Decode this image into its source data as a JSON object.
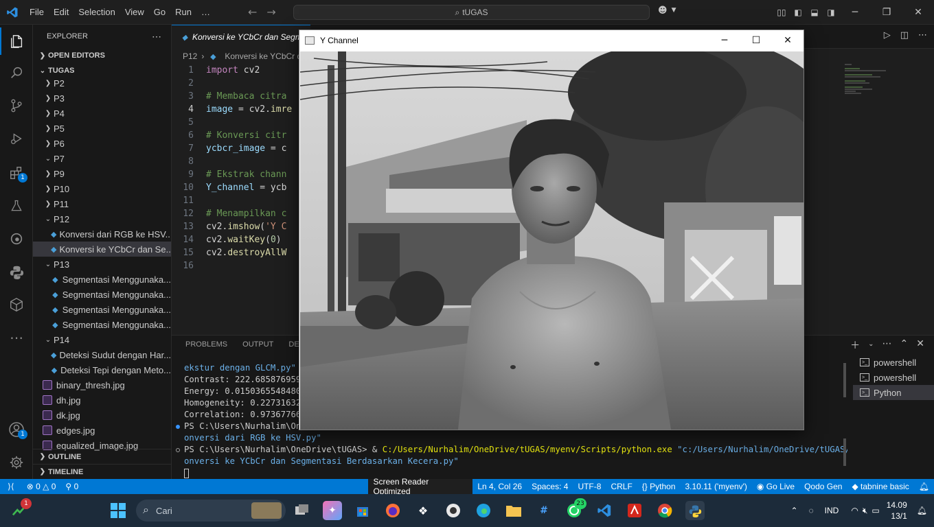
{
  "titlebar": {
    "menus": [
      "File",
      "Edit",
      "Selection",
      "View",
      "Go",
      "Run",
      "…"
    ],
    "search_text": "tUGAS"
  },
  "activity": {
    "extensions_badge": "1",
    "accounts_badge": "1"
  },
  "explorer": {
    "title": "EXPLORER",
    "open_editors": "OPEN EDITORS",
    "workspace": "TUGAS",
    "rows": [
      {
        "label": "P2",
        "type": "folder-closed"
      },
      {
        "label": "P3",
        "type": "folder-closed"
      },
      {
        "label": "P4",
        "type": "folder-closed"
      },
      {
        "label": "P5",
        "type": "folder-closed"
      },
      {
        "label": "P6",
        "type": "folder-closed"
      },
      {
        "label": "P7",
        "type": "folder-open"
      },
      {
        "label": "P9",
        "type": "folder-closed"
      },
      {
        "label": "P10",
        "type": "folder-closed"
      },
      {
        "label": "P11",
        "type": "folder-closed"
      },
      {
        "label": "P12",
        "type": "folder-open"
      },
      {
        "label": "Konversi dari RGB ke HSV....",
        "type": "py"
      },
      {
        "label": "Konversi ke YCbCr dan Se...",
        "type": "py",
        "selected": true
      },
      {
        "label": "P13",
        "type": "folder-open"
      },
      {
        "label": "Segmentasi Menggunaka...",
        "type": "py"
      },
      {
        "label": "Segmentasi Menggunaka...",
        "type": "py"
      },
      {
        "label": "Segmentasi Menggunaka...",
        "type": "py"
      },
      {
        "label": "Segmentasi Menggunaka...",
        "type": "py"
      },
      {
        "label": "P14",
        "type": "folder-open"
      },
      {
        "label": "Deteksi Sudut dengan Har...",
        "type": "py"
      },
      {
        "label": "Deteksi Tepi dengan Meto...",
        "type": "py"
      },
      {
        "label": "binary_thresh.jpg",
        "type": "img"
      },
      {
        "label": "dh.jpg",
        "type": "img"
      },
      {
        "label": "dk.jpg",
        "type": "img"
      },
      {
        "label": "edges.jpg",
        "type": "img"
      },
      {
        "label": "equalized_image.jpg",
        "type": "img"
      }
    ],
    "outline": "OUTLINE",
    "timeline": "TIMELINE"
  },
  "editor": {
    "tab_label": "Konversi ke YCbCr dan Segm",
    "breadcrumb_folder": "P12",
    "breadcrumb_file": "Konversi ke YCbCr d",
    "lines": [
      {
        "n": "1",
        "parts": [
          {
            "c": "c-kw",
            "t": "import"
          },
          {
            "c": "c-plain",
            "t": " cv2"
          }
        ]
      },
      {
        "n": "2",
        "parts": []
      },
      {
        "n": "3",
        "parts": [
          {
            "c": "c-cm",
            "t": "# Membaca citra"
          }
        ]
      },
      {
        "n": "4",
        "parts": [
          {
            "c": "c-var",
            "t": "image"
          },
          {
            "c": "c-plain",
            "t": " = cv2."
          },
          {
            "c": "c-fn",
            "t": "imre"
          }
        ]
      },
      {
        "n": "5",
        "parts": []
      },
      {
        "n": "6",
        "parts": [
          {
            "c": "c-cm",
            "t": "# Konversi citr"
          }
        ]
      },
      {
        "n": "7",
        "parts": [
          {
            "c": "c-var",
            "t": "ycbcr_image"
          },
          {
            "c": "c-plain",
            "t": " = c"
          }
        ]
      },
      {
        "n": "8",
        "parts": []
      },
      {
        "n": "9",
        "parts": [
          {
            "c": "c-cm",
            "t": "# Ekstrak chann"
          }
        ]
      },
      {
        "n": "10",
        "parts": [
          {
            "c": "c-var",
            "t": "Y_channel"
          },
          {
            "c": "c-plain",
            "t": " = ycb"
          }
        ]
      },
      {
        "n": "11",
        "parts": []
      },
      {
        "n": "12",
        "parts": [
          {
            "c": "c-cm",
            "t": "# Menampilkan c"
          }
        ]
      },
      {
        "n": "13",
        "parts": [
          {
            "c": "c-plain",
            "t": "cv2."
          },
          {
            "c": "c-fn",
            "t": "imshow"
          },
          {
            "c": "c-plain",
            "t": "("
          },
          {
            "c": "c-str",
            "t": "'Y C"
          }
        ]
      },
      {
        "n": "14",
        "parts": [
          {
            "c": "c-plain",
            "t": "cv2."
          },
          {
            "c": "c-fn",
            "t": "waitKey"
          },
          {
            "c": "c-plain",
            "t": "("
          },
          {
            "c": "c-num",
            "t": "0"
          },
          {
            "c": "c-plain",
            "t": ")"
          }
        ]
      },
      {
        "n": "15",
        "parts": [
          {
            "c": "c-plain",
            "t": "cv2."
          },
          {
            "c": "c-fn",
            "t": "destroyAllW"
          }
        ]
      },
      {
        "n": "16",
        "parts": []
      }
    ],
    "current_line": "4"
  },
  "panel": {
    "tabs": [
      "PROBLEMS",
      "OUTPUT",
      "DEBU"
    ],
    "terminal": [
      {
        "kind": "plain",
        "dot": "",
        "parts": [
          {
            "c": "t-s",
            "t": "ekstur dengan GLCM.py\""
          }
        ]
      },
      {
        "kind": "plain",
        "dot": "",
        "parts": [
          {
            "c": "",
            "t": "Contrast: 222.6858769594"
          }
        ]
      },
      {
        "kind": "plain",
        "dot": "",
        "parts": [
          {
            "c": "",
            "t": "Energy: 0.01503655484800"
          }
        ]
      },
      {
        "kind": "plain",
        "dot": "",
        "parts": [
          {
            "c": "",
            "t": "Homogeneity: 0.227316326"
          }
        ]
      },
      {
        "kind": "plain",
        "dot": "",
        "parts": [
          {
            "c": "",
            "t": "Correlation: 0.973677668"
          }
        ]
      },
      {
        "kind": "prompt",
        "dot": "blue",
        "parts": [
          {
            "c": "",
            "t": "PS C:\\Users\\Nurhalim\\One"
          },
          {
            "c": "",
            "t": "                                                             "
          },
          {
            "c": "t-s",
            "t": "tUGAS/P12/K"
          }
        ]
      },
      {
        "kind": "plain",
        "dot": "",
        "parts": [
          {
            "c": "t-s",
            "t": "onversi dari RGB ke HSV.py\""
          }
        ]
      },
      {
        "kind": "prompt",
        "dot": "hollow",
        "parts": [
          {
            "c": "",
            "t": "PS C:\\Users\\Nurhalim\\OneDrive\\tUGAS> & "
          },
          {
            "c": "t-y",
            "t": "C:/Users/Nurhalim/OneDrive/tUGAS/myenv/Scripts/python.exe"
          },
          {
            "c": "",
            "t": " "
          },
          {
            "c": "t-s",
            "t": "\"c:/Users/Nurhalim/OneDrive/tUGAS/P12/K"
          }
        ]
      },
      {
        "kind": "plain",
        "dot": "",
        "parts": [
          {
            "c": "t-s",
            "t": "onversi ke YCbCr dan Segmentasi Berdasarkan Kecera.py\""
          }
        ]
      }
    ],
    "terminals": [
      {
        "label": "powershell",
        "selected": false
      },
      {
        "label": "powershell",
        "selected": false
      },
      {
        "label": "Python",
        "selected": true
      }
    ]
  },
  "statusbar": {
    "errors": "0",
    "warnings": "0",
    "ports": "0",
    "reader": "Screen Reader Optimized",
    "position": "Ln 4, Col 26",
    "spaces": "Spaces: 4",
    "encoding": "UTF-8",
    "eol": "CRLF",
    "language": "Python",
    "interpreter": "3.10.11 ('myenv')",
    "golive": "Go Live",
    "qodo": "Qodo Gen",
    "tabnine": "tabnine basic"
  },
  "cv_window": {
    "title": "Y Channel"
  },
  "taskbar": {
    "search_placeholder": "Cari",
    "widget_badge": "1",
    "whatsapp_badge": "23",
    "lang": "IND",
    "time": "14.09",
    "date": "13/1"
  }
}
